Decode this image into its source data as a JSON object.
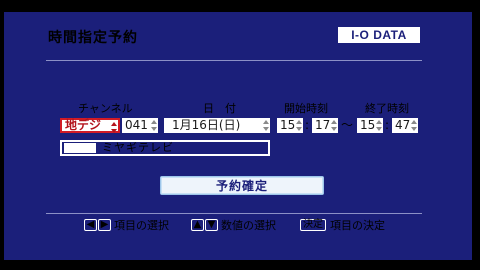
{
  "header": {
    "title": "時間指定予約",
    "logo": "I-O DATA"
  },
  "labels": {
    "channel": "チャンネル",
    "date": "日　付",
    "start": "開始時刻",
    "end": "終了時刻"
  },
  "form": {
    "broadcast_type": "地デジ",
    "channel_number": "041",
    "date": "1月16日(日)",
    "start_hour": "15",
    "start_minute": "17",
    "range_sep": "〜",
    "end_hour": "15",
    "end_minute": "47",
    "time_colon": ":",
    "station_name": "ミヤギテレビ"
  },
  "buttons": {
    "confirm": "予約確定"
  },
  "help": {
    "left_icon": "◀",
    "right_icon": "▶",
    "select_item": "項目の選択",
    "up_icon": "▲",
    "down_icon": "▼",
    "select_value": "数値の選択",
    "decide_key": "決定",
    "decide_item": "項目の決定"
  },
  "colors": {
    "background": "#1b1f7a",
    "highlight": "#d21b26",
    "logo_bg": "#ffffff"
  }
}
